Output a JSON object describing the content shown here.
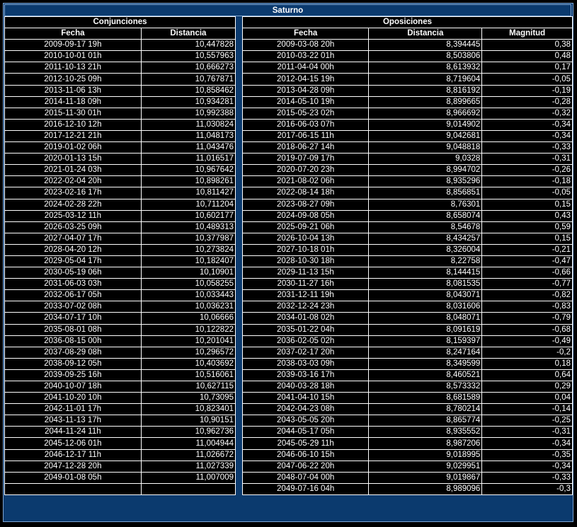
{
  "title": "Saturno",
  "conj": {
    "heading": "Conjunciones",
    "col_fecha": "Fecha",
    "col_dist": "Distancia",
    "rows": [
      [
        "2009-09-17 19h",
        "10,447828"
      ],
      [
        "2010-10-01 01h",
        "10,557963"
      ],
      [
        "2011-10-13 21h",
        "10,666273"
      ],
      [
        "2012-10-25 09h",
        "10,767871"
      ],
      [
        "2013-11-06 13h",
        "10,858462"
      ],
      [
        "2014-11-18 09h",
        "10,934281"
      ],
      [
        "2015-11-30 01h",
        "10,992388"
      ],
      [
        "2016-12-10 12h",
        "11,030824"
      ],
      [
        "2017-12-21 21h",
        "11,048173"
      ],
      [
        "2019-01-02 06h",
        "11,043476"
      ],
      [
        "2020-01-13 15h",
        "11,016517"
      ],
      [
        "2021-01-24 03h",
        "10,967642"
      ],
      [
        "2022-02-04 20h",
        "10,898261"
      ],
      [
        "2023-02-16 17h",
        "10,811427"
      ],
      [
        "2024-02-28 22h",
        "10,711204"
      ],
      [
        "2025-03-12 11h",
        "10,602177"
      ],
      [
        "2026-03-25 09h",
        "10,489313"
      ],
      [
        "2027-04-07 17h",
        "10,377987"
      ],
      [
        "2028-04-20 12h",
        "10,273824"
      ],
      [
        "2029-05-04 17h",
        "10,182407"
      ],
      [
        "2030-05-19 06h",
        "10,10901"
      ],
      [
        "2031-06-03 03h",
        "10,058255"
      ],
      [
        "2032-06-17 05h",
        "10,033443"
      ],
      [
        "2033-07-02 08h",
        "10,036231"
      ],
      [
        "2034-07-17 10h",
        "10,06666"
      ],
      [
        "2035-08-01 08h",
        "10,122822"
      ],
      [
        "2036-08-15 00h",
        "10,201041"
      ],
      [
        "2037-08-29 08h",
        "10,296572"
      ],
      [
        "2038-09-12 05h",
        "10,403692"
      ],
      [
        "2039-09-25 16h",
        "10,516061"
      ],
      [
        "2040-10-07 18h",
        "10,627115"
      ],
      [
        "2041-10-20 10h",
        "10,73095"
      ],
      [
        "2042-11-01 17h",
        "10,823401"
      ],
      [
        "2043-11-13 17h",
        "10,90151"
      ],
      [
        "2044-11-24 11h",
        "10,962736"
      ],
      [
        "2045-12-06 01h",
        "11,004944"
      ],
      [
        "2046-12-17 11h",
        "11,026672"
      ],
      [
        "2047-12-28 20h",
        "11,027339"
      ],
      [
        "2049-01-08 05h",
        "11,007009"
      ],
      [
        "",
        ""
      ]
    ]
  },
  "opos": {
    "heading": "Oposiciones",
    "col_fecha": "Fecha",
    "col_dist": "Distancia",
    "col_mag": "Magnitud",
    "rows": [
      [
        "2009-03-08 20h",
        "8,394445",
        "0,38"
      ],
      [
        "2010-03-22 01h",
        "8,503806",
        "0,48"
      ],
      [
        "2011-04-04 00h",
        "8,613932",
        "0,17"
      ],
      [
        "2012-04-15 19h",
        "8,719604",
        "-0,05"
      ],
      [
        "2013-04-28 09h",
        "8,816192",
        "-0,19"
      ],
      [
        "2014-05-10 19h",
        "8,899665",
        "-0,28"
      ],
      [
        "2015-05-23 02h",
        "8,966692",
        "-0,32"
      ],
      [
        "2016-06-03 07h",
        "9,014902",
        "-0,34"
      ],
      [
        "2017-06-15 11h",
        "9,042681",
        "-0,34"
      ],
      [
        "2018-06-27 14h",
        "9,048818",
        "-0,33"
      ],
      [
        "2019-07-09 17h",
        "9,0328",
        "-0,31"
      ],
      [
        "2020-07-20 23h",
        "8,994702",
        "-0,26"
      ],
      [
        "2021-08-02 06h",
        "8,935296",
        "-0,18"
      ],
      [
        "2022-08-14 18h",
        "8,856851",
        "-0,05"
      ],
      [
        "2023-08-27 09h",
        "8,76301",
        "0,15"
      ],
      [
        "2024-09-08 05h",
        "8,658074",
        "0,43"
      ],
      [
        "2025-09-21 06h",
        "8,54678",
        "0,59"
      ],
      [
        "2026-10-04 13h",
        "8,434257",
        "0,15"
      ],
      [
        "2027-10-18 01h",
        "8,326004",
        "-0,21"
      ],
      [
        "2028-10-30 18h",
        "8,22758",
        "-0,47"
      ],
      [
        "2029-11-13 15h",
        "8,144415",
        "-0,66"
      ],
      [
        "2030-11-27 16h",
        "8,081535",
        "-0,77"
      ],
      [
        "2031-12-11 19h",
        "8,043071",
        "-0,82"
      ],
      [
        "2032-12-24 23h",
        "8,031606",
        "-0,83"
      ],
      [
        "2034-01-08 02h",
        "8,048071",
        "-0,79"
      ],
      [
        "2035-01-22 04h",
        "8,091619",
        "-0,68"
      ],
      [
        "2036-02-05 02h",
        "8,159397",
        "-0,49"
      ],
      [
        "2037-02-17 20h",
        "8,247164",
        "-0,2"
      ],
      [
        "2038-03-03 09h",
        "8,349599",
        "0,18"
      ],
      [
        "2039-03-16 17h",
        "8,460521",
        "0,64"
      ],
      [
        "2040-03-28 18h",
        "8,573332",
        "0,29"
      ],
      [
        "2041-04-10 15h",
        "8,681589",
        "0,04"
      ],
      [
        "2042-04-23 08h",
        "8,780214",
        "-0,14"
      ],
      [
        "2043-05-05 20h",
        "8,865774",
        "-0,25"
      ],
      [
        "2044-05-17 05h",
        "8,935552",
        "-0,31"
      ],
      [
        "2045-05-29 11h",
        "8,987206",
        "-0,34"
      ],
      [
        "2046-06-10 15h",
        "9,018995",
        "-0,35"
      ],
      [
        "2047-06-22 20h",
        "9,029951",
        "-0,34"
      ],
      [
        "2048-07-04 00h",
        "9,019867",
        "-0,33"
      ],
      [
        "2049-07-16 04h",
        "8,989096",
        "-0,3"
      ]
    ]
  }
}
